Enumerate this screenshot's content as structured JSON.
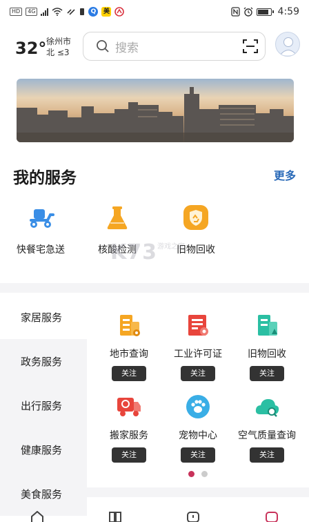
{
  "status_bar": {
    "chips": [
      "HD",
      "4G"
    ],
    "app_badge": "美",
    "time": "4:59"
  },
  "header": {
    "temperature": "32°",
    "city": "徐州市",
    "wind": "北 ≤3",
    "search_placeholder": "搜索"
  },
  "my_services": {
    "title": "我的服务",
    "more_label": "更多",
    "items": [
      {
        "label": "快餐宅急送",
        "icon": "scooter-icon",
        "color": "#3a8ee6"
      },
      {
        "label": "核酸检测",
        "icon": "flask-icon",
        "color": "#f5a623"
      },
      {
        "label": "旧物回收",
        "icon": "recycle-shield-icon",
        "color": "#f5a623"
      }
    ]
  },
  "watermark": {
    "text": "K73",
    "sub": "游戏之家"
  },
  "categories": {
    "items": [
      {
        "label": "家居服务",
        "active": true
      },
      {
        "label": "政务服务",
        "active": false
      },
      {
        "label": "出行服务",
        "active": false
      },
      {
        "label": "健康服务",
        "active": false
      },
      {
        "label": "美食服务",
        "active": false
      }
    ]
  },
  "grid": {
    "follow_label": "关注",
    "items": [
      {
        "label": "地市查询",
        "icon": "building-icon",
        "color": "#f5a623"
      },
      {
        "label": "工业许可证",
        "icon": "certificate-icon",
        "color": "#e8453c"
      },
      {
        "label": "旧物回收",
        "icon": "recycle-building-icon",
        "color": "#2bbfa3"
      },
      {
        "label": "搬家服务",
        "icon": "truck-icon",
        "color": "#e8453c"
      },
      {
        "label": "宠物中心",
        "icon": "paw-icon",
        "color": "#3aaee6"
      },
      {
        "label": "空气质量查询",
        "icon": "cloud-search-icon",
        "color": "#2bbfa3"
      }
    ]
  },
  "pager": {
    "active_color": "#c8325a",
    "inactive_color": "#cccccc"
  }
}
